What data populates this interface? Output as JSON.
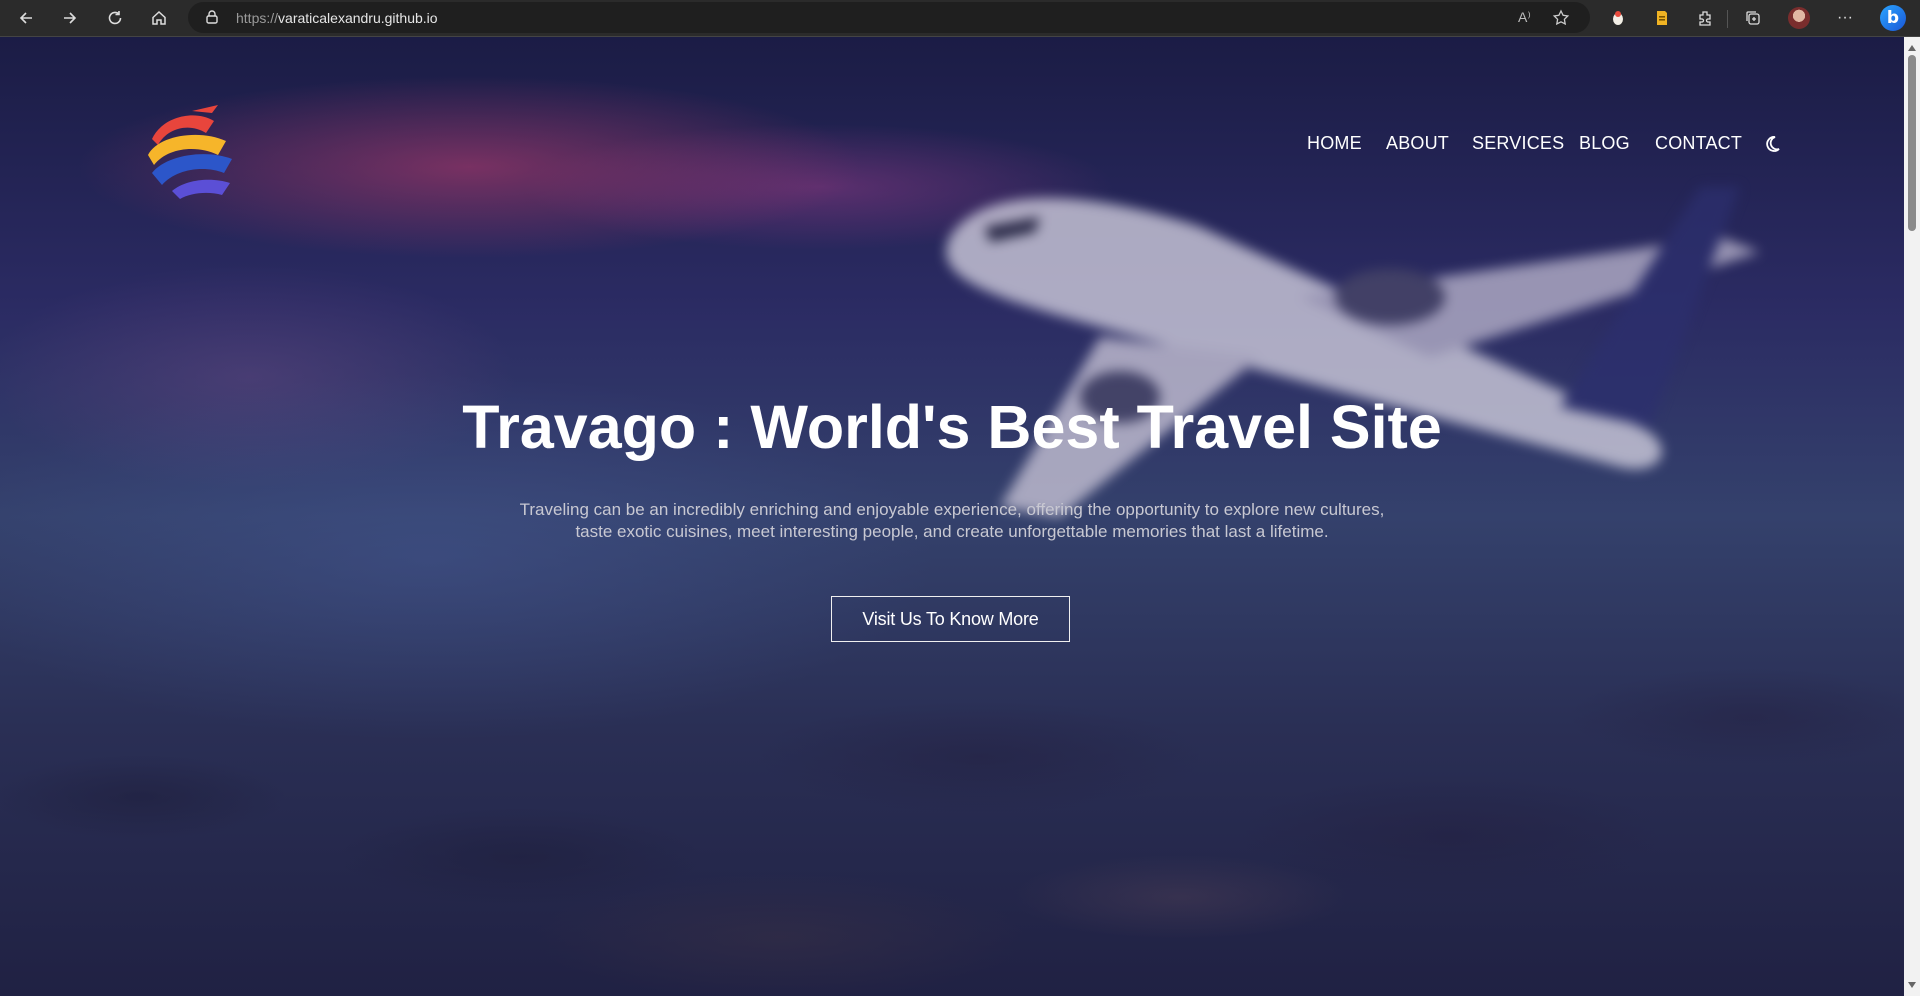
{
  "browser": {
    "url_protocol": "https://",
    "url_host": "varaticalexandru.github.io",
    "icons": [
      "back-icon",
      "forward-icon",
      "refresh-icon",
      "home-icon",
      "lock-icon",
      "read-aloud-icon",
      "favorite-icon",
      "extension-icon",
      "collections-icon",
      "profile-icon",
      "more-icon",
      "bing-icon"
    ],
    "read_aloud_label": "A⁾",
    "more_label": "···",
    "bing_label": "b"
  },
  "site": {
    "nav": {
      "home": "HOME",
      "about": "ABOUT",
      "services": "SERVICES",
      "blog": "BLOG",
      "contact": "CONTACT"
    },
    "hero": {
      "title": "Travago : World's Best Travel Site",
      "description_line1": "Traveling can be an incredibly enriching and enjoyable experience, offering the opportunity to explore new cultures,",
      "description_line2": "taste exotic cuisines, meet interesting people, and create unforgettable memories that last a lifetime.",
      "cta_label": "Visit Us To Know More"
    },
    "colors": {
      "logo": [
        "#e8453c",
        "#f6b52a",
        "#2c56c9",
        "#5b4fd6"
      ],
      "text": "#ffffff",
      "description": "#c8c8d2"
    }
  }
}
